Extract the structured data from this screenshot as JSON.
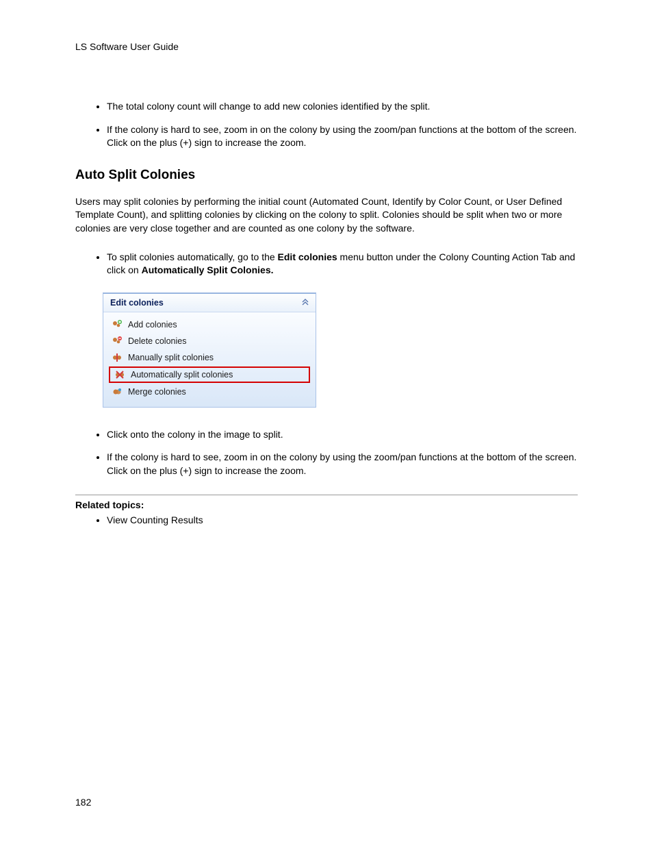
{
  "header": "LS Software User Guide",
  "topBullets": [
    "The total colony count will change to add new colonies identified by the split.",
    "If the colony is hard to see, zoom in on the colony by using the zoom/pan functions at the bottom of the screen.  Click on the plus (+) sign to increase the zoom."
  ],
  "sectionHeading": "Auto Split Colonies",
  "sectionPara": "Users may split colonies by performing the initial count (Automated Count, Identify by Color Count, or User Defined Template Count), and splitting colonies by clicking on the colony to split. Colonies should be split when two or more colonies are very close together and are counted as one colony by the software.",
  "stepBullet": {
    "pre": "To split colonies automatically, go to the ",
    "bold1": "Edit colonies",
    "mid": " menu button under the Colony Counting Action Tab and click on ",
    "bold2": "Automatically Split Colonies."
  },
  "panel": {
    "title": "Edit colonies",
    "items": [
      {
        "label": "Add colonies",
        "icon": "add-colonies-icon",
        "highlighted": false
      },
      {
        "label": "Delete colonies",
        "icon": "delete-colonies-icon",
        "highlighted": false
      },
      {
        "label": "Manually split colonies",
        "icon": "manual-split-icon",
        "highlighted": false
      },
      {
        "label": "Automatically split colonies",
        "icon": "auto-split-icon",
        "highlighted": true
      },
      {
        "label": "Merge colonies",
        "icon": "merge-colonies-icon",
        "highlighted": false
      }
    ]
  },
  "afterPanelBullets": [
    "Click onto the colony in the image to split.",
    "If the colony is hard to see, zoom in on the colony by using the zoom/pan functions at the bottom of the screen.  Click on the plus (+) sign to increase the zoom."
  ],
  "relatedHeading": "Related topics:",
  "relatedItems": [
    "View Counting Results"
  ],
  "pageNumber": "182"
}
